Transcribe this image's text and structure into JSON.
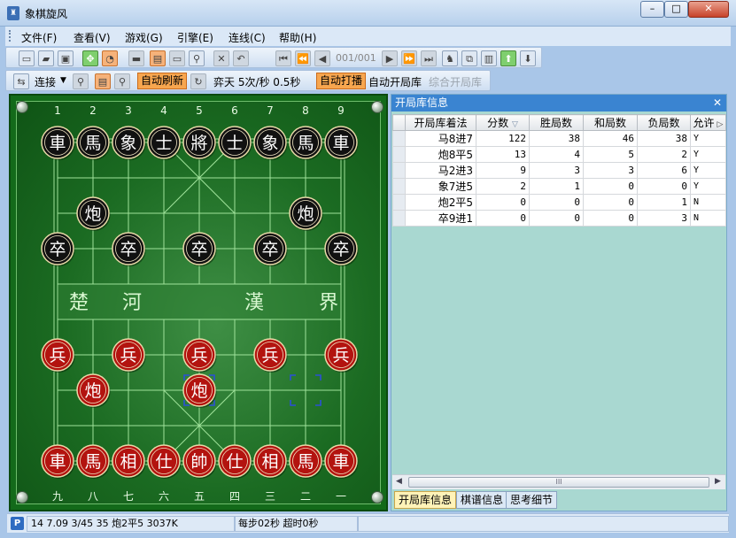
{
  "window": {
    "title": "象棋旋风",
    "min": "–",
    "max": "□",
    "close": "✕"
  },
  "menu": [
    "文件(F)",
    "查看(V)",
    "游戏(G)",
    "引擎(E)",
    "连线(C)",
    "帮助(H)"
  ],
  "toolbar": {
    "move_counter": "001/001",
    "connect_label": "连接",
    "auto_refresh": "自动刷新",
    "engine_speed": "弈天 5次/秒 0.5秒",
    "auto_play": "自动打播",
    "auto_open_book": "自动开局库",
    "combined_book": "综合开局库"
  },
  "board": {
    "top_files": [
      "1",
      "2",
      "3",
      "4",
      "5",
      "6",
      "7",
      "8",
      "9"
    ],
    "bottom_files": [
      "九",
      "八",
      "七",
      "六",
      "五",
      "四",
      "三",
      "二",
      "一"
    ],
    "river_left": [
      "楚",
      "河"
    ],
    "river_right": [
      "漢",
      "界"
    ],
    "black_pieces": [
      {
        "name": "車",
        "col": 0,
        "row": 0
      },
      {
        "name": "馬",
        "col": 1,
        "row": 0
      },
      {
        "name": "象",
        "col": 2,
        "row": 0
      },
      {
        "name": "士",
        "col": 3,
        "row": 0
      },
      {
        "name": "將",
        "col": 4,
        "row": 0
      },
      {
        "name": "士",
        "col": 5,
        "row": 0
      },
      {
        "name": "象",
        "col": 6,
        "row": 0
      },
      {
        "name": "馬",
        "col": 7,
        "row": 0
      },
      {
        "name": "車",
        "col": 8,
        "row": 0
      },
      {
        "name": "炮",
        "col": 1,
        "row": 2
      },
      {
        "name": "炮",
        "col": 7,
        "row": 2
      },
      {
        "name": "卒",
        "col": 0,
        "row": 3
      },
      {
        "name": "卒",
        "col": 2,
        "row": 3
      },
      {
        "name": "卒",
        "col": 4,
        "row": 3
      },
      {
        "name": "卒",
        "col": 6,
        "row": 3
      },
      {
        "name": "卒",
        "col": 8,
        "row": 3
      }
    ],
    "red_pieces": [
      {
        "name": "兵",
        "col": 0,
        "row": 6
      },
      {
        "name": "兵",
        "col": 2,
        "row": 6
      },
      {
        "name": "兵",
        "col": 4,
        "row": 6
      },
      {
        "name": "兵",
        "col": 6,
        "row": 6
      },
      {
        "name": "兵",
        "col": 8,
        "row": 6
      },
      {
        "name": "炮",
        "col": 1,
        "row": 7
      },
      {
        "name": "炮",
        "col": 4,
        "row": 7
      },
      {
        "name": "車",
        "col": 0,
        "row": 9
      },
      {
        "name": "馬",
        "col": 1,
        "row": 9
      },
      {
        "name": "相",
        "col": 2,
        "row": 9
      },
      {
        "name": "仕",
        "col": 3,
        "row": 9
      },
      {
        "name": "帥",
        "col": 4,
        "row": 9
      },
      {
        "name": "仕",
        "col": 5,
        "row": 9
      },
      {
        "name": "相",
        "col": 6,
        "row": 9
      },
      {
        "name": "馬",
        "col": 7,
        "row": 9
      },
      {
        "name": "車",
        "col": 8,
        "row": 9
      }
    ],
    "last_move": {
      "from": {
        "col": 7,
        "row": 7
      },
      "to": {
        "col": 4,
        "row": 7
      }
    },
    "colors": {
      "board": "#1b6b22",
      "line": "#9fe29a",
      "black_piece": "#111111",
      "red_piece": "#b3130f"
    }
  },
  "panel": {
    "title": "开局库信息",
    "close": "✕",
    "columns": [
      "开局库着法",
      "分数",
      "胜局数",
      "和局数",
      "负局数",
      "允许"
    ],
    "rows": [
      {
        "move": "马8进7",
        "score": "122",
        "win": "38",
        "draw": "46",
        "loss": "38",
        "allow": "Y"
      },
      {
        "move": "炮8平5",
        "score": "13",
        "win": "4",
        "draw": "5",
        "loss": "2",
        "allow": "Y"
      },
      {
        "move": "马2进3",
        "score": "9",
        "win": "3",
        "draw": "3",
        "loss": "6",
        "allow": "Y"
      },
      {
        "move": "象7进5",
        "score": "2",
        "win": "1",
        "draw": "0",
        "loss": "0",
        "allow": "Y"
      },
      {
        "move": "炮2平5",
        "score": "0",
        "win": "0",
        "draw": "0",
        "loss": "1",
        "allow": "N"
      },
      {
        "move": "卒9进1",
        "score": "0",
        "win": "0",
        "draw": "0",
        "loss": "3",
        "allow": "N"
      }
    ],
    "scroll_grip": "III",
    "tabs": [
      "开局库信息",
      "棋谱信息",
      "思考细节"
    ]
  },
  "status": {
    "icon": "P",
    "info": "14 7.09 3/45 35 炮2平5 3037K",
    "timer": "每步02秒 超时0秒"
  }
}
